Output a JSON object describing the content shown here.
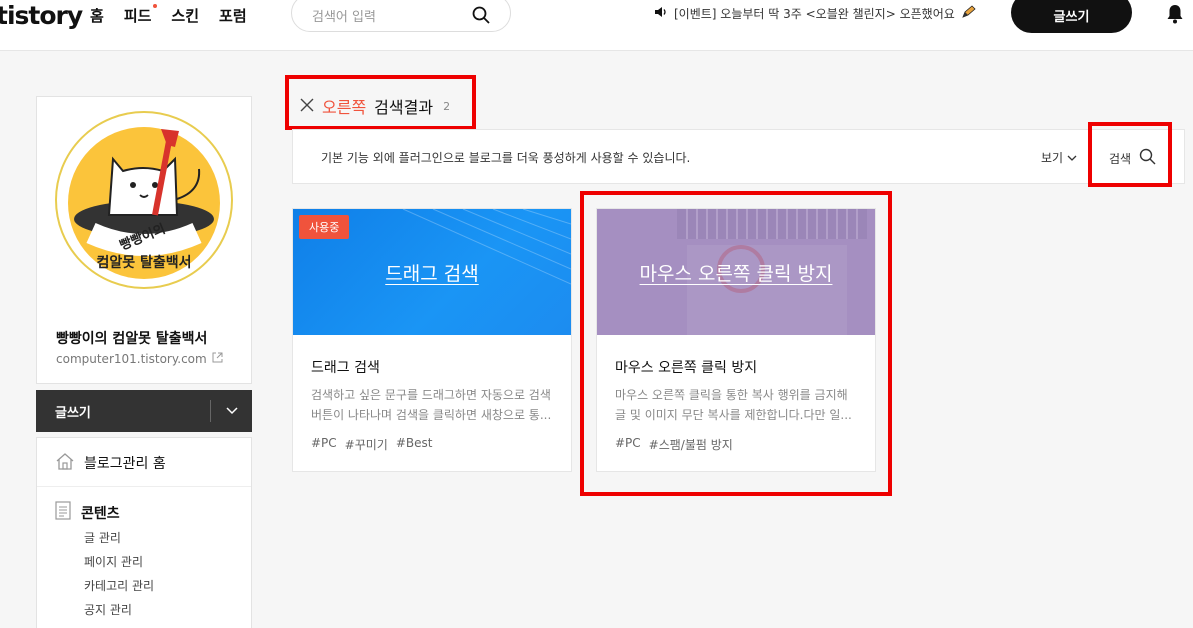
{
  "header": {
    "logo": "tistory",
    "nav": [
      "홈",
      "피드",
      "스킨",
      "포럼"
    ],
    "search_placeholder": "검색어 입력",
    "notice": "[이벤트] 오늘부터 딱 3주 <오블완 챌린지> 오픈했어요",
    "write_label": "글쓰기"
  },
  "sidebar": {
    "blog_name": "빵빵이의 컴알못 탈출백서",
    "blog_url": "computer101.tistory.com",
    "badge_text": "빵빵이의 컴알못 탈출백서",
    "write_label": "글쓰기",
    "home_label": "블로그관리 홈",
    "content_group": "콘텐츠",
    "content_items": [
      "글 관리",
      "페이지 관리",
      "카테고리 관리",
      "공지 관리"
    ]
  },
  "main": {
    "keyword": "오른쪽",
    "result_label": "검색결과",
    "result_count": "2",
    "description": "기본 기능 외에 플러그인으로 블로그를 더욱 풍성하게 사용할 수 있습니다.",
    "view_label": "보기",
    "search_label": "검색",
    "cards": [
      {
        "badge": "사용중",
        "thumb_title": "드래그 검색",
        "title": "드래그 검색",
        "desc": "검색하고 싶은 문구를 드래그하면 자동으로 검색 버튼이 나타나며 검색을 클릭하면 새창으로 통...",
        "tags": [
          "#PC",
          "#꾸미기",
          "#Best"
        ],
        "thumb_color": "#1a8cf0"
      },
      {
        "badge": "",
        "thumb_title": "마우스 오른쪽 클릭 방지",
        "title": "마우스 오른쪽 클릭 방지",
        "desc": "마우스 오른쪽 클릭을 통한 복사 행위를 금지해 글 및 이미지 무단 복사를 제한합니다.다만 일...",
        "tags": [
          "#PC",
          "#스팸/불펌 방지"
        ],
        "thumb_color": "#a58fc1"
      }
    ]
  },
  "colors": {
    "accent": "#f0533c",
    "highlight": "#ee0000"
  }
}
